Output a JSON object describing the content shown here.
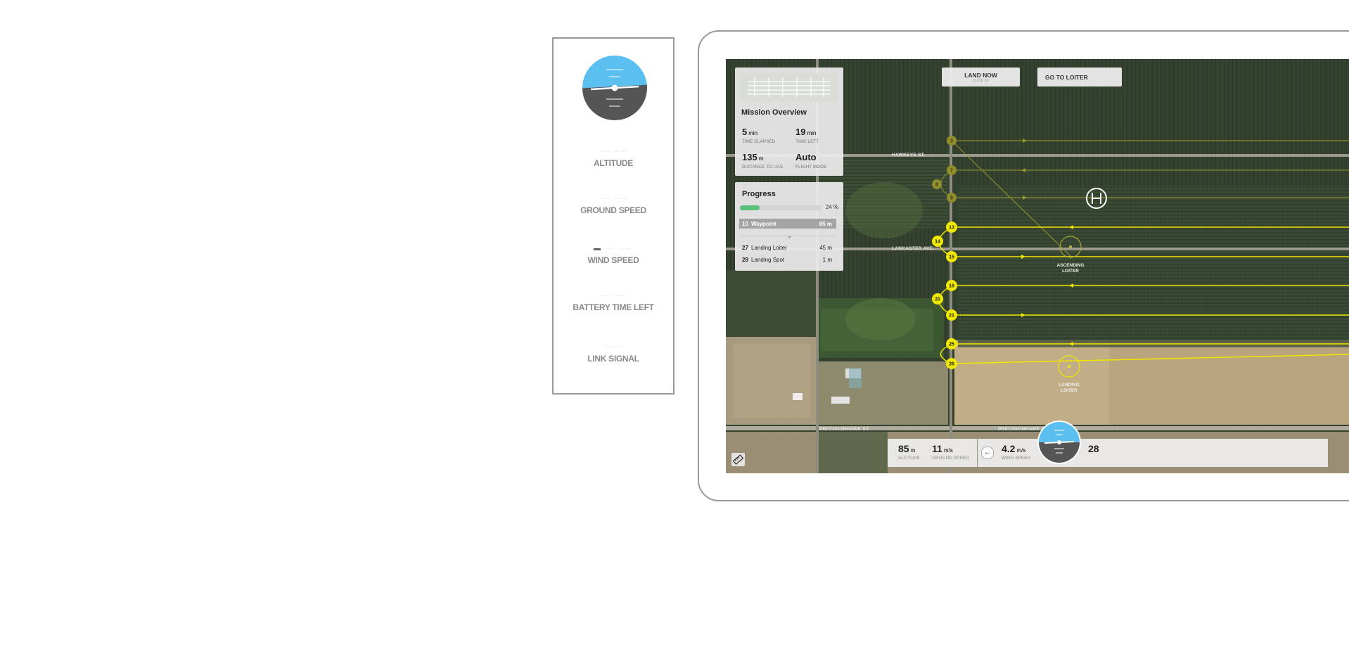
{
  "strip": {
    "metrics": [
      {
        "label": "ALTITUDE"
      },
      {
        "label": "GROUND SPEED"
      },
      {
        "label": "WIND SPEED"
      },
      {
        "label": "BATTERY TIME LEFT"
      },
      {
        "label": "LINK SIGNAL"
      }
    ]
  },
  "buttons": {
    "land_now": "LAND NOW",
    "land_now_sub": "CLICK 3X",
    "go_to_loiter": "GO TO LOITER"
  },
  "mission": {
    "title": "Mission Overview",
    "time_elapsed": {
      "value": "5",
      "unit": "min",
      "label": "TIME ELAPSED"
    },
    "time_left": {
      "value": "19",
      "unit": "min",
      "label": "TIME LEFT"
    },
    "distance": {
      "value": "135",
      "unit": "m",
      "label": "DISTANCE TO UAS"
    },
    "flight_mode": {
      "value": "Auto",
      "label": "FLIGHT MODE"
    }
  },
  "progress": {
    "title": "Progress",
    "percent": 24,
    "percent_text": "24 %",
    "current": {
      "num": "10",
      "name": "Waypoint",
      "dist": "85 m"
    },
    "upcoming": [
      {
        "num": "27",
        "name": "Landing Loiter",
        "dist": "45 m"
      },
      {
        "num": "28",
        "name": "Landing Spot",
        "dist": "1 m"
      }
    ]
  },
  "map": {
    "streets": [
      "HAWKEYE ST.",
      "LANCASTER AVE.",
      "PRECISIONHAWK ST.",
      "PRECISIONHAWK ST."
    ],
    "zones": {
      "ascending": "ASCENDING LOITER",
      "landing": "LANDING LOITER"
    },
    "waypoints_active": [
      "13",
      "14",
      "15",
      "19",
      "20",
      "21",
      "25",
      "26"
    ],
    "waypoints_done": [
      "3",
      "7",
      "8",
      "9"
    ],
    "home_icon": "helipad-icon"
  },
  "bottom": {
    "altitude": {
      "value": "85",
      "unit": "m",
      "label": "ALTITUDE"
    },
    "ground_speed": {
      "value": "11",
      "unit": "m/s",
      "label": "GROUND SPEED"
    },
    "wind_speed": {
      "value": "4.2",
      "unit": "m/s",
      "label": "WIND SPEED"
    },
    "battery_partial": "28"
  },
  "colors": {
    "sky": "#5bc0f0",
    "ground": "#555555",
    "route": "#f0e800",
    "progress": "#5cbf7a"
  }
}
